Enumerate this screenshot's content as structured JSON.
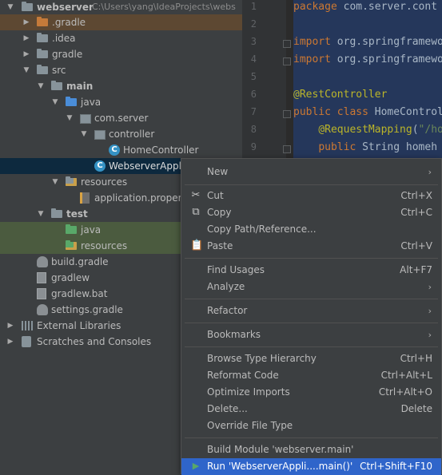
{
  "tree": {
    "root": {
      "label": "webserver",
      "path": "C:\\Users\\yang\\IdeaProjects\\webs"
    },
    "items": [
      {
        "label": ".gradle"
      },
      {
        "label": ".idea"
      },
      {
        "label": "gradle"
      },
      {
        "label": "src"
      },
      {
        "label": "main"
      },
      {
        "label": "java"
      },
      {
        "label": "com.server"
      },
      {
        "label": "controller"
      },
      {
        "label": "HomeController"
      },
      {
        "label": "WebserverApplic"
      },
      {
        "label": "resources"
      },
      {
        "label": "application.properties"
      },
      {
        "label": "test"
      },
      {
        "label": "java"
      },
      {
        "label": "resources"
      },
      {
        "label": "build.gradle"
      },
      {
        "label": "gradlew"
      },
      {
        "label": "gradlew.bat"
      },
      {
        "label": "settings.gradle"
      },
      {
        "label": "External Libraries"
      },
      {
        "label": "Scratches and Consoles"
      }
    ]
  },
  "editor": {
    "line_numbers": [
      "1",
      "2",
      "3",
      "4",
      "5",
      "6",
      "7",
      "8",
      "9"
    ],
    "lines": [
      {
        "parts": [
          {
            "cls": "k",
            "text": "package "
          },
          {
            "cls": "cls",
            "text": "com.server.cont"
          }
        ]
      },
      {
        "parts": []
      },
      {
        "parts": [
          {
            "cls": "k",
            "text": "import "
          },
          {
            "cls": "cls",
            "text": "org.springframewo"
          }
        ]
      },
      {
        "parts": [
          {
            "cls": "k",
            "text": "import "
          },
          {
            "cls": "cls",
            "text": "org.springframewo"
          }
        ]
      },
      {
        "parts": []
      },
      {
        "parts": [
          {
            "cls": "a",
            "text": "@RestController"
          }
        ]
      },
      {
        "parts": [
          {
            "cls": "k",
            "text": "public class "
          },
          {
            "cls": "cls",
            "text": "HomeControl"
          }
        ]
      },
      {
        "parts": [
          {
            "cls": "cls",
            "text": "    "
          },
          {
            "cls": "a",
            "text": "@RequestMapping"
          },
          {
            "cls": "cls",
            "text": "("
          },
          {
            "cls": "s",
            "text": "\"/ho"
          }
        ]
      },
      {
        "parts": [
          {
            "cls": "cls",
            "text": "    "
          },
          {
            "cls": "k",
            "text": "public "
          },
          {
            "cls": "cls",
            "text": "String homeh"
          }
        ]
      }
    ]
  },
  "menu": {
    "items": [
      {
        "label": "New",
        "shortcut": "",
        "submenu": true,
        "icon": ""
      },
      {
        "label": "Cut",
        "shortcut": "Ctrl+X",
        "submenu": false,
        "icon": "scissors-icon"
      },
      {
        "label": "Copy",
        "shortcut": "Ctrl+C",
        "submenu": false,
        "icon": "copy-icon"
      },
      {
        "label": "Copy Path/Reference...",
        "shortcut": "",
        "submenu": false,
        "icon": ""
      },
      {
        "label": "Paste",
        "shortcut": "Ctrl+V",
        "submenu": false,
        "icon": "paste-icon"
      },
      {
        "label": "Find Usages",
        "shortcut": "Alt+F7",
        "submenu": false,
        "icon": ""
      },
      {
        "label": "Analyze",
        "shortcut": "",
        "submenu": true,
        "icon": ""
      },
      {
        "label": "Refactor",
        "shortcut": "",
        "submenu": true,
        "icon": ""
      },
      {
        "label": "Bookmarks",
        "shortcut": "",
        "submenu": true,
        "icon": ""
      },
      {
        "label": "Browse Type Hierarchy",
        "shortcut": "Ctrl+H",
        "submenu": false,
        "icon": ""
      },
      {
        "label": "Reformat Code",
        "shortcut": "Ctrl+Alt+L",
        "submenu": false,
        "icon": ""
      },
      {
        "label": "Optimize Imports",
        "shortcut": "Ctrl+Alt+O",
        "submenu": false,
        "icon": ""
      },
      {
        "label": "Delete...",
        "shortcut": "Delete",
        "submenu": false,
        "icon": ""
      },
      {
        "label": "Override File Type",
        "shortcut": "",
        "submenu": false,
        "icon": ""
      },
      {
        "label": "Build Module 'webserver.main'",
        "shortcut": "",
        "submenu": false,
        "icon": ""
      },
      {
        "label": "Run 'WebserverAppli....main()'",
        "shortcut": "Ctrl+Shift+F10",
        "submenu": false,
        "icon": "run-icon"
      }
    ]
  },
  "colors": {
    "accent": "#2f65ca",
    "folder": "#87939a",
    "source_folder": "#4a8dd8",
    "excluded": "#c47a3a",
    "test": "#59a869",
    "run": "#499c54"
  }
}
